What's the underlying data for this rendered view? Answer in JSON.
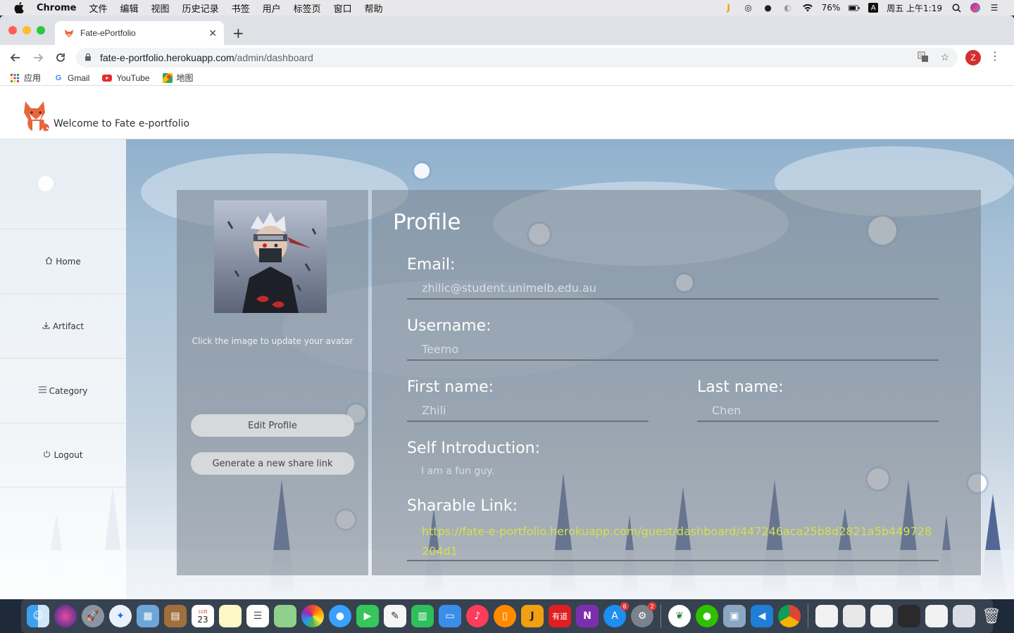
{
  "menubar": {
    "app_name": "Chrome",
    "menus": [
      "文件",
      "编辑",
      "视图",
      "历史记录",
      "书签",
      "用户",
      "标签页",
      "窗口",
      "帮助"
    ],
    "battery": "76%",
    "input_method": "A",
    "clock": "周五 上午1:19"
  },
  "browser": {
    "tab_title": "Fate-ePortfolio",
    "url_host": "fate-e-portfolio.herokuapp.com",
    "url_path": "/admin/dashboard",
    "profile_initial": "Z",
    "bookmarks": [
      {
        "label": "应用",
        "icon": "apps-grid-icon"
      },
      {
        "label": "Gmail",
        "icon": "google-icon"
      },
      {
        "label": "YouTube",
        "icon": "youtube-icon"
      },
      {
        "label": "地图",
        "icon": "maps-icon"
      }
    ]
  },
  "site": {
    "title": "Welcome to Fate e-portfolio",
    "sidebar": [
      {
        "label": "Home",
        "icon": "home-icon"
      },
      {
        "label": "Artifact",
        "icon": "upload-icon"
      },
      {
        "label": "Category",
        "icon": "menu-icon"
      },
      {
        "label": "Logout",
        "icon": "power-icon"
      }
    ],
    "avatar_hint": "Click the image to update your avatar",
    "edit_profile_label": "Edit Profile",
    "share_link_button_label": "Generate a new share link"
  },
  "profile": {
    "title": "Profile",
    "email_label": "Email:",
    "email_value": "zhilic@student.unimelb.edu.au",
    "username_label": "Username:",
    "username_value": "Teemo",
    "first_name_label": "First name:",
    "first_name_value": "Zhili",
    "last_name_label": "Last name:",
    "last_name_value": "Chen",
    "intro_label": "Self Introduction:",
    "intro_value": "I am a fun guy.",
    "link_label": "Sharable Link:",
    "link_value": "https://fate-e-portfolio.herokuapp.com/guest/dashboard/447246aca25b8d2821a5b449728204d1"
  },
  "dock": {
    "apps": [
      "finder-icon",
      "siri-icon",
      "launchpad-icon",
      "safari-icon",
      "preview-icon",
      "notes-book-icon",
      "calendar-icon",
      "notes-icon",
      "reminders-icon",
      "maps-icon",
      "photos-icon",
      "messages-icon",
      "facetime-icon",
      "textedit-icon",
      "numbers-icon",
      "keynote-icon",
      "music-icon",
      "books-icon",
      "jetbrains-icon",
      "youdao-icon",
      "onenote-icon",
      "appstore-icon",
      "settings-icon",
      "mongodb-icon",
      "wechat-icon",
      "image-capture-icon",
      "vscode-icon",
      "chrome-icon"
    ],
    "calendar_day": "23",
    "appstore_badge": "6",
    "settings_badge": "2"
  },
  "colors": {
    "accent_link": "#d4e04a",
    "panel_bg": "rgba(120,130,140,0.55)"
  }
}
